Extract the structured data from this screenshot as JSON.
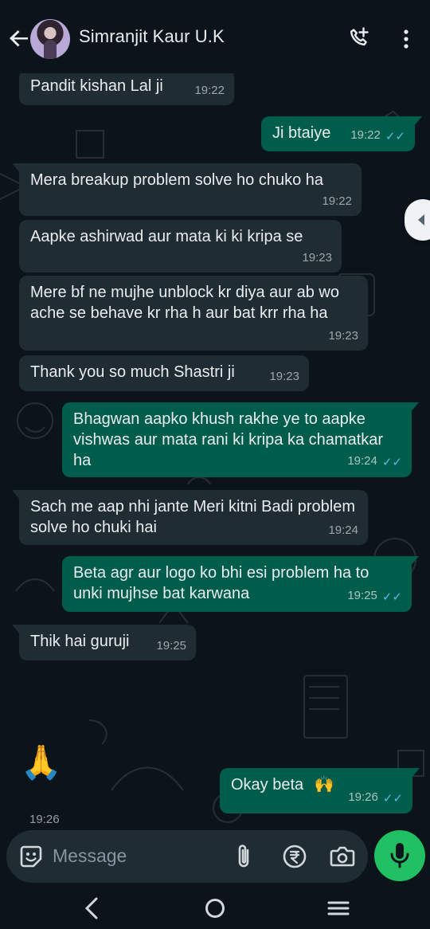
{
  "app": {
    "contact_name": "Simranjit Kaur U.K",
    "accent": "#21c063",
    "incoming_bubble": "#202c33",
    "outgoing_bubble": "#005c4b",
    "read_receipt": "#53bdeb"
  },
  "header": {
    "icons": [
      "back-arrow-icon",
      "avatar",
      "add-call-icon",
      "more-vertical-icon"
    ]
  },
  "messages": [
    {
      "direction": "incoming",
      "text": "Pandit kishan Lal ji",
      "time": "19:22"
    },
    {
      "direction": "outgoing",
      "text": "Ji btaiye",
      "time": "19:22",
      "status": "read"
    },
    {
      "direction": "incoming",
      "text": "Mera breakup problem solve ho chuko ha",
      "time": "19:22"
    },
    {
      "direction": "incoming",
      "text": "Aapke ashirwad aur mata ki ki kripa se",
      "time": "19:23"
    },
    {
      "direction": "incoming",
      "text": "Mere bf ne mujhe unblock kr diya aur ab wo ache se behave kr rha h aur bat krr rha ha",
      "time": "19:23"
    },
    {
      "direction": "incoming",
      "text": "Thank you so much Shastri ji",
      "time": "19:23"
    },
    {
      "direction": "outgoing",
      "text": "Bhagwan aapko khush rakhe ye to aapke vishwas aur mata rani ki kripa ka chamatkar ha",
      "time": "19:24",
      "status": "read"
    },
    {
      "direction": "incoming",
      "text": "Sach me aap nhi jante Meri kitni Badi problem solve ho chuki hai",
      "time": "19:24"
    },
    {
      "direction": "outgoing",
      "text": "Beta agr aur logo ko bhi esi problem ha to unki mujhse bat karwana",
      "time": "19:25",
      "status": "read"
    },
    {
      "direction": "incoming",
      "text": "Thik hai guruji",
      "time": "19:25"
    },
    {
      "direction": "incoming",
      "text": "🙏",
      "time": "19:26",
      "kind": "emoji"
    },
    {
      "direction": "outgoing",
      "text": "Okay beta",
      "emoji": "🙌",
      "time": "19:26",
      "status": "read"
    }
  ],
  "composer": {
    "placeholder": "Message",
    "icons": [
      "emoji-icon",
      "attach-icon",
      "rupee-icon",
      "camera-icon",
      "mic-icon"
    ]
  },
  "system_nav": {
    "icons": [
      "nav-back-icon",
      "nav-home-icon",
      "nav-menu-icon"
    ]
  }
}
